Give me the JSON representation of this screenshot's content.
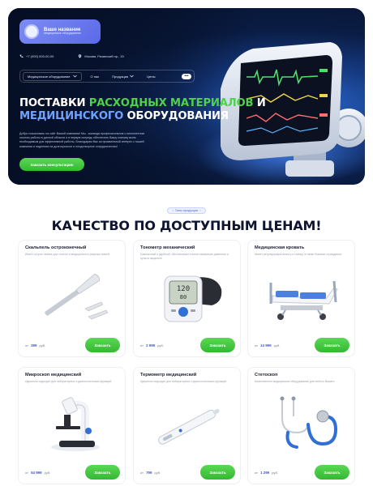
{
  "brand": {
    "title": "Ваше название",
    "subtitle": "Медицинское оборудование"
  },
  "contacts": {
    "phone": "+7 (000) 000-00-00",
    "address": "Москва, Рязанский пр., 15"
  },
  "nav": {
    "category": "Медицинское оборудование",
    "items": [
      "О нас",
      "Продукция",
      "Цены"
    ],
    "more": "•••"
  },
  "hero": {
    "line1_a": "ПОСТАВКИ ",
    "line1_b": "РАСХОДНЫХ МАТЕРИАЛОВ",
    "line1_c": " И",
    "line2_a": "МЕДИЦИНСКОГО ",
    "line2_b": "ОБОРУДОВАНИЯ",
    "description": "Добро пожаловать на сайт Вашей компании! Мы - команда профессионалов с многолетним опытом работы в данной области и в первую очередь обеспечить Вашу клинику всем необходимым для эффективной работы. Благодарим Вас за проявленный интерес к нашей компании и надеемся на долгосрочное и плодотворное сотрудничество!",
    "cta": "Заказать консультацию"
  },
  "section": {
    "badge": "Типы продукции",
    "title": "КАЧЕСТВО ПО ДОСТУПНЫМ ЦЕНАМ!"
  },
  "products": [
    {
      "name": "Скальпель остроконечный",
      "desc": "Имеет острое лезвие для точного и медицинского разреза тканей.",
      "price_prefix": "от",
      "price": "399",
      "currency": "руб.",
      "button": "Заказать",
      "icon": "scalpel-icon"
    },
    {
      "name": "Тонометр механический",
      "desc": "Компактный и удобный, обеспечивает точное измерение давления и пульса пациента.",
      "price_prefix": "от",
      "price": "2 999",
      "currency": "руб.",
      "button": "Заказать",
      "icon": "tonometer-icon"
    },
    {
      "name": "Медицинская кровать",
      "desc": "Имеет регулируемую высоту и спинку, а также боковые ограждения.",
      "price_prefix": "от",
      "price": "14 999",
      "currency": "руб.",
      "button": "Заказать",
      "icon": "hospital-bed-icon"
    },
    {
      "name": "Микроскоп медицинский",
      "desc": "Идеально подходит для лабораторных и диагностических функций.",
      "price_prefix": "от",
      "price": "54 999",
      "currency": "руб.",
      "button": "Заказать",
      "icon": "microscope-icon"
    },
    {
      "name": "Термометр медицинский",
      "desc": "Идеально подходит для лабораторных и диагностических функций.",
      "price_prefix": "от",
      "price": "799",
      "currency": "руб.",
      "button": "Заказать",
      "icon": "thermometer-icon"
    },
    {
      "name": "Стетоскоп",
      "desc": "Качественное медицинское оборудование для любого Вашего",
      "price_prefix": "от",
      "price": "1 299",
      "currency": "руб.",
      "button": "Заказать",
      "icon": "stethoscope-icon"
    }
  ],
  "colors": {
    "accent_green": "#3fc43c",
    "accent_blue": "#5b6ae8",
    "hero_dark": "#06122c",
    "title_dark": "#0f1530"
  }
}
